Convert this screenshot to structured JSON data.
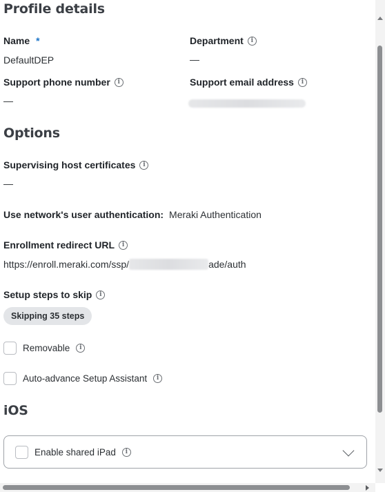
{
  "profile_details": {
    "heading": "Profile details",
    "name_label": "Name",
    "name_required_marker": "*",
    "name_value": "DefaultDEP",
    "department_label": "Department",
    "department_value": "—",
    "phone_label": "Support phone number",
    "phone_value": "—",
    "email_label": "Support email address"
  },
  "options": {
    "heading": "Options",
    "supervising_label": "Supervising host certificates",
    "supervising_value": "—",
    "auth_label": "Use network's user authentication:",
    "auth_value": "Meraki Authentication",
    "redirect_label": "Enrollment redirect URL",
    "redirect_prefix": "https://enroll.meraki.com/ssp/",
    "redirect_suffix": "ade/auth",
    "skip_label": "Setup steps to skip",
    "skip_button": "Skipping 35 steps",
    "removable_label": "Removable",
    "autoadvance_label": "Auto-advance Setup Assistant"
  },
  "ios": {
    "heading": "iOS",
    "shared_ipad_label": "Enable shared iPad"
  },
  "icons": {
    "info": "info-circle-icon",
    "chevron": "chevron-down-icon"
  },
  "colors": {
    "required": "#1a73c8",
    "text": "#1f2328",
    "pill_bg": "#e3e5e8",
    "border": "#9ea2a8"
  }
}
